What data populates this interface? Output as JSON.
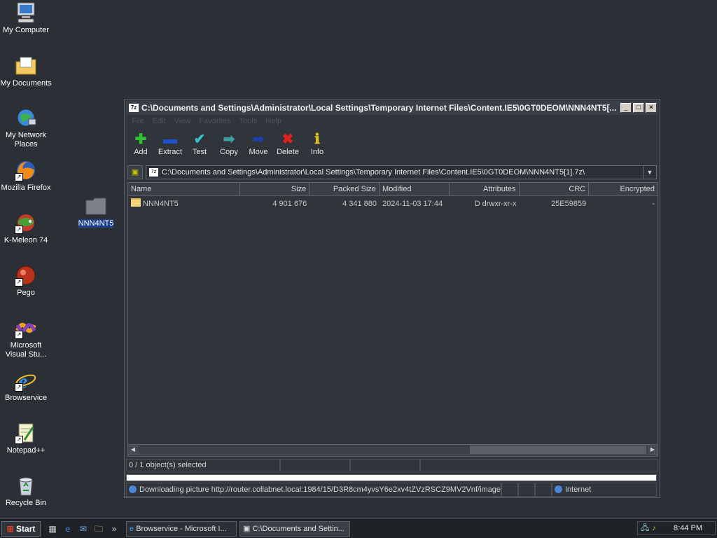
{
  "desktop": {
    "icons": [
      {
        "label": "My Computer"
      },
      {
        "label": "My Documents"
      },
      {
        "label": "My Network Places"
      },
      {
        "label": "Mozilla Firefox"
      },
      {
        "label": "K-Meleon 74"
      },
      {
        "label": "Pego"
      },
      {
        "label": "Microsoft Visual Stu..."
      },
      {
        "label": "Browservice"
      },
      {
        "label": "Notepad++"
      },
      {
        "label": "Recycle Bin"
      },
      {
        "label": "NNN4NT5"
      }
    ]
  },
  "window": {
    "title_icon": "7z",
    "title": "C:\\Documents and Settings\\Administrator\\Local Settings\\Temporary Internet Files\\Content.IE5\\0GT0DEOM\\NNN4NT5[...",
    "menu": [
      "File",
      "Edit",
      "View",
      "Favorites",
      "Tools",
      "Help"
    ],
    "toolbar": [
      {
        "label": "Add",
        "icon": "plus-icon",
        "color": "#2ec22e"
      },
      {
        "label": "Extract",
        "icon": "minus-icon",
        "color": "#2050d0"
      },
      {
        "label": "Test",
        "icon": "check-icon",
        "color": "#38c0c8"
      },
      {
        "label": "Copy",
        "icon": "copy-arrow-icon",
        "color": "#3aa0a0"
      },
      {
        "label": "Move",
        "icon": "move-arrow-icon",
        "color": "#2040b0"
      },
      {
        "label": "Delete",
        "icon": "delete-x-icon",
        "color": "#e02020"
      },
      {
        "label": "Info",
        "icon": "info-icon",
        "color": "#e0c020"
      }
    ],
    "address": "C:\\Documents and Settings\\Administrator\\Local Settings\\Temporary Internet Files\\Content.IE5\\0GT0DEOM\\NNN4NT5[1].7z\\",
    "columns": [
      "Name",
      "Size",
      "Packed Size",
      "Modified",
      "Attributes",
      "CRC",
      "Encrypted"
    ],
    "rows": [
      {
        "name": "NNN4NT5",
        "size": "4 901 676",
        "packed": "4 341 880",
        "modified": "2024-11-03 17:44",
        "attributes": "D drwxr-xr-x",
        "crc": "25E59859",
        "encrypted": "-"
      }
    ],
    "status": "0 / 1 object(s) selected"
  },
  "ie_status": {
    "text": "Downloading picture http://router.collabnet.local:1984/15/D3R8cm4yvsY6e2xv4tZVzRSCZ9MV2Vnf/image/",
    "zone": "Internet"
  },
  "taskbar": {
    "start_label": "Start",
    "tasks": [
      {
        "label": "Browservice - Microsoft I..."
      },
      {
        "label": "C:\\Documents and Settin..."
      }
    ],
    "clock": "8:44 PM"
  }
}
